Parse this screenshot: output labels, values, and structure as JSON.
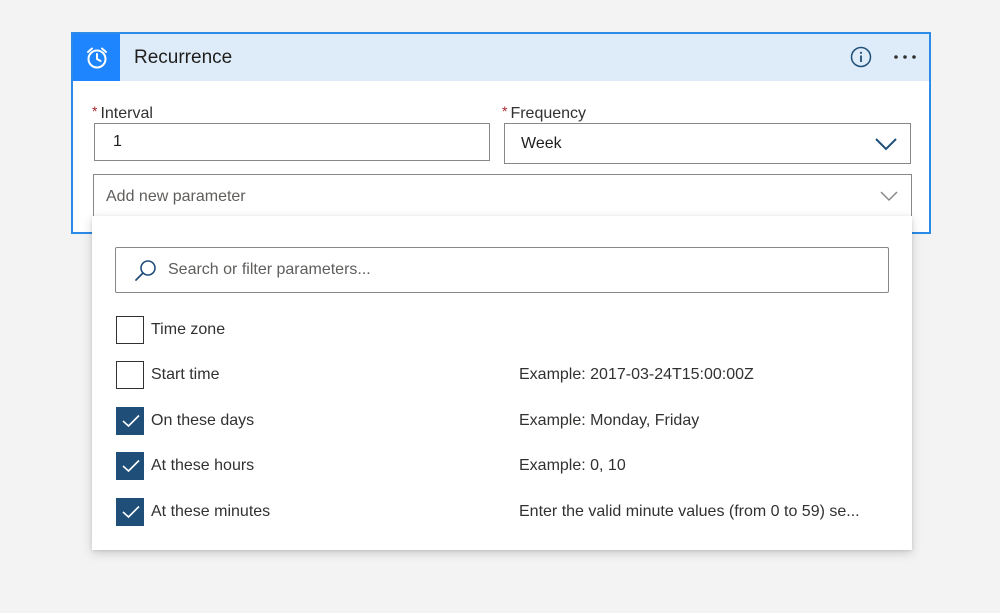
{
  "card": {
    "title": "Recurrence",
    "icon": "alarm-clock-icon",
    "accent_color": "#1f85ff",
    "header_bg": "#deecf9"
  },
  "interval": {
    "label": "Interval",
    "required_mark": "*",
    "value": "1"
  },
  "frequency": {
    "label": "Frequency",
    "required_mark": "*",
    "value": "Week"
  },
  "add_param": {
    "placeholder": "Add new parameter"
  },
  "search": {
    "placeholder": "Search or filter parameters..."
  },
  "parameters": [
    {
      "label": "Time zone",
      "hint": "",
      "checked": false
    },
    {
      "label": "Start time",
      "hint": "Example: 2017-03-24T15:00:00Z",
      "checked": false
    },
    {
      "label": "On these days",
      "hint": "Example: Monday, Friday",
      "checked": true
    },
    {
      "label": "At these hours",
      "hint": "Example: 0, 10",
      "checked": true
    },
    {
      "label": "At these minutes",
      "hint": "Enter the valid minute values (from 0 to 59) se...",
      "checked": true
    }
  ]
}
